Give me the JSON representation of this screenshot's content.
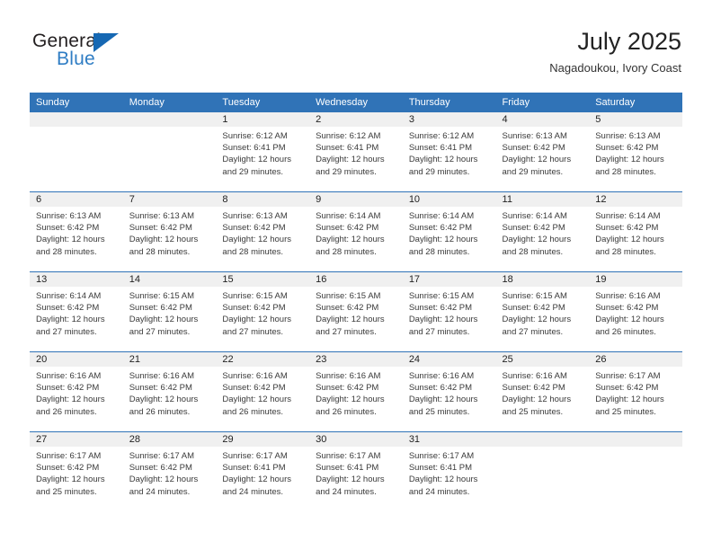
{
  "brand": {
    "name_part1": "General",
    "name_part2": "Blue",
    "logo_icon": "triangle-logo-icon",
    "accent_color": "#1668b3",
    "text_color": "#2f7dc4"
  },
  "header": {
    "title": "July 2025",
    "location": "Nagadoukou, Ivory Coast"
  },
  "theme": {
    "header_blue": "#3073b7",
    "daynum_band": "#f0f0f0",
    "grid_line": "#3073b7"
  },
  "weekday_headers": [
    "Sunday",
    "Monday",
    "Tuesday",
    "Wednesday",
    "Thursday",
    "Friday",
    "Saturday"
  ],
  "labels": {
    "sunrise_prefix": "Sunrise:",
    "sunset_prefix": "Sunset:",
    "daylight_prefix": "Daylight:"
  },
  "weeks": [
    [
      {
        "day": "",
        "blank": true,
        "sunrise": "",
        "sunset": "",
        "daylight": ""
      },
      {
        "day": "",
        "blank": true,
        "sunrise": "",
        "sunset": "",
        "daylight": ""
      },
      {
        "day": "1",
        "blank": false,
        "sunrise": "Sunrise: 6:12 AM",
        "sunset": "Sunset: 6:41 PM",
        "daylight": "Daylight: 12 hours and 29 minutes."
      },
      {
        "day": "2",
        "blank": false,
        "sunrise": "Sunrise: 6:12 AM",
        "sunset": "Sunset: 6:41 PM",
        "daylight": "Daylight: 12 hours and 29 minutes."
      },
      {
        "day": "3",
        "blank": false,
        "sunrise": "Sunrise: 6:12 AM",
        "sunset": "Sunset: 6:41 PM",
        "daylight": "Daylight: 12 hours and 29 minutes."
      },
      {
        "day": "4",
        "blank": false,
        "sunrise": "Sunrise: 6:13 AM",
        "sunset": "Sunset: 6:42 PM",
        "daylight": "Daylight: 12 hours and 29 minutes."
      },
      {
        "day": "5",
        "blank": false,
        "sunrise": "Sunrise: 6:13 AM",
        "sunset": "Sunset: 6:42 PM",
        "daylight": "Daylight: 12 hours and 28 minutes."
      }
    ],
    [
      {
        "day": "6",
        "blank": false,
        "sunrise": "Sunrise: 6:13 AM",
        "sunset": "Sunset: 6:42 PM",
        "daylight": "Daylight: 12 hours and 28 minutes."
      },
      {
        "day": "7",
        "blank": false,
        "sunrise": "Sunrise: 6:13 AM",
        "sunset": "Sunset: 6:42 PM",
        "daylight": "Daylight: 12 hours and 28 minutes."
      },
      {
        "day": "8",
        "blank": false,
        "sunrise": "Sunrise: 6:13 AM",
        "sunset": "Sunset: 6:42 PM",
        "daylight": "Daylight: 12 hours and 28 minutes."
      },
      {
        "day": "9",
        "blank": false,
        "sunrise": "Sunrise: 6:14 AM",
        "sunset": "Sunset: 6:42 PM",
        "daylight": "Daylight: 12 hours and 28 minutes."
      },
      {
        "day": "10",
        "blank": false,
        "sunrise": "Sunrise: 6:14 AM",
        "sunset": "Sunset: 6:42 PM",
        "daylight": "Daylight: 12 hours and 28 minutes."
      },
      {
        "day": "11",
        "blank": false,
        "sunrise": "Sunrise: 6:14 AM",
        "sunset": "Sunset: 6:42 PM",
        "daylight": "Daylight: 12 hours and 28 minutes."
      },
      {
        "day": "12",
        "blank": false,
        "sunrise": "Sunrise: 6:14 AM",
        "sunset": "Sunset: 6:42 PM",
        "daylight": "Daylight: 12 hours and 28 minutes."
      }
    ],
    [
      {
        "day": "13",
        "blank": false,
        "sunrise": "Sunrise: 6:14 AM",
        "sunset": "Sunset: 6:42 PM",
        "daylight": "Daylight: 12 hours and 27 minutes."
      },
      {
        "day": "14",
        "blank": false,
        "sunrise": "Sunrise: 6:15 AM",
        "sunset": "Sunset: 6:42 PM",
        "daylight": "Daylight: 12 hours and 27 minutes."
      },
      {
        "day": "15",
        "blank": false,
        "sunrise": "Sunrise: 6:15 AM",
        "sunset": "Sunset: 6:42 PM",
        "daylight": "Daylight: 12 hours and 27 minutes."
      },
      {
        "day": "16",
        "blank": false,
        "sunrise": "Sunrise: 6:15 AM",
        "sunset": "Sunset: 6:42 PM",
        "daylight": "Daylight: 12 hours and 27 minutes."
      },
      {
        "day": "17",
        "blank": false,
        "sunrise": "Sunrise: 6:15 AM",
        "sunset": "Sunset: 6:42 PM",
        "daylight": "Daylight: 12 hours and 27 minutes."
      },
      {
        "day": "18",
        "blank": false,
        "sunrise": "Sunrise: 6:15 AM",
        "sunset": "Sunset: 6:42 PM",
        "daylight": "Daylight: 12 hours and 27 minutes."
      },
      {
        "day": "19",
        "blank": false,
        "sunrise": "Sunrise: 6:16 AM",
        "sunset": "Sunset: 6:42 PM",
        "daylight": "Daylight: 12 hours and 26 minutes."
      }
    ],
    [
      {
        "day": "20",
        "blank": false,
        "sunrise": "Sunrise: 6:16 AM",
        "sunset": "Sunset: 6:42 PM",
        "daylight": "Daylight: 12 hours and 26 minutes."
      },
      {
        "day": "21",
        "blank": false,
        "sunrise": "Sunrise: 6:16 AM",
        "sunset": "Sunset: 6:42 PM",
        "daylight": "Daylight: 12 hours and 26 minutes."
      },
      {
        "day": "22",
        "blank": false,
        "sunrise": "Sunrise: 6:16 AM",
        "sunset": "Sunset: 6:42 PM",
        "daylight": "Daylight: 12 hours and 26 minutes."
      },
      {
        "day": "23",
        "blank": false,
        "sunrise": "Sunrise: 6:16 AM",
        "sunset": "Sunset: 6:42 PM",
        "daylight": "Daylight: 12 hours and 26 minutes."
      },
      {
        "day": "24",
        "blank": false,
        "sunrise": "Sunrise: 6:16 AM",
        "sunset": "Sunset: 6:42 PM",
        "daylight": "Daylight: 12 hours and 25 minutes."
      },
      {
        "day": "25",
        "blank": false,
        "sunrise": "Sunrise: 6:16 AM",
        "sunset": "Sunset: 6:42 PM",
        "daylight": "Daylight: 12 hours and 25 minutes."
      },
      {
        "day": "26",
        "blank": false,
        "sunrise": "Sunrise: 6:17 AM",
        "sunset": "Sunset: 6:42 PM",
        "daylight": "Daylight: 12 hours and 25 minutes."
      }
    ],
    [
      {
        "day": "27",
        "blank": false,
        "sunrise": "Sunrise: 6:17 AM",
        "sunset": "Sunset: 6:42 PM",
        "daylight": "Daylight: 12 hours and 25 minutes."
      },
      {
        "day": "28",
        "blank": false,
        "sunrise": "Sunrise: 6:17 AM",
        "sunset": "Sunset: 6:42 PM",
        "daylight": "Daylight: 12 hours and 24 minutes."
      },
      {
        "day": "29",
        "blank": false,
        "sunrise": "Sunrise: 6:17 AM",
        "sunset": "Sunset: 6:41 PM",
        "daylight": "Daylight: 12 hours and 24 minutes."
      },
      {
        "day": "30",
        "blank": false,
        "sunrise": "Sunrise: 6:17 AM",
        "sunset": "Sunset: 6:41 PM",
        "daylight": "Daylight: 12 hours and 24 minutes."
      },
      {
        "day": "31",
        "blank": false,
        "sunrise": "Sunrise: 6:17 AM",
        "sunset": "Sunset: 6:41 PM",
        "daylight": "Daylight: 12 hours and 24 minutes."
      },
      {
        "day": "",
        "blank": true,
        "sunrise": "",
        "sunset": "",
        "daylight": ""
      },
      {
        "day": "",
        "blank": true,
        "sunrise": "",
        "sunset": "",
        "daylight": ""
      }
    ]
  ]
}
